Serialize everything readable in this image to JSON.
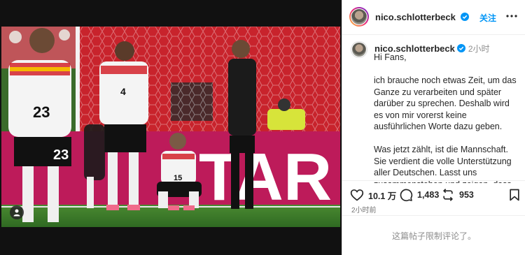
{
  "post": {
    "username": "nico.schlotterbeck",
    "follow_label": "关注",
    "caption_time": "2小时",
    "caption_text": "Hi Fans,\n\nich brauche noch etwas Zeit, um das Ganze zu verarbeiten und später darüber zu sprechen. Deshalb wird es von mir vorerst keine ausführlichen Worte dazu geben.\n\nWas jetzt zählt, ist die Mannschaft. Sie verdient die volle Unterstützung aller Deutschen. Lasst uns zusammenstehen und zeigen, dass wir in guten wie in schwierigen",
    "likes": "10.1 万",
    "comments": "1,483",
    "shares": "953",
    "post_age": "2小时前",
    "comments_disabled": "这篇帖子限制评论了。"
  },
  "photo": {
    "board_text": "TAR",
    "jersey_numbers": [
      "23",
      "4",
      "15",
      "23",
      "4"
    ]
  },
  "colors": {
    "accent": "#0095f6",
    "verified": "#0095f6",
    "muted": "#8e8e8e",
    "stand_red": "#c8232c",
    "pitch": "#3f7d2b"
  },
  "icons": [
    "person-tag-icon",
    "verified-badge-icon",
    "more-icon",
    "heart-icon",
    "comment-icon",
    "repost-icon",
    "bookmark-icon"
  ]
}
